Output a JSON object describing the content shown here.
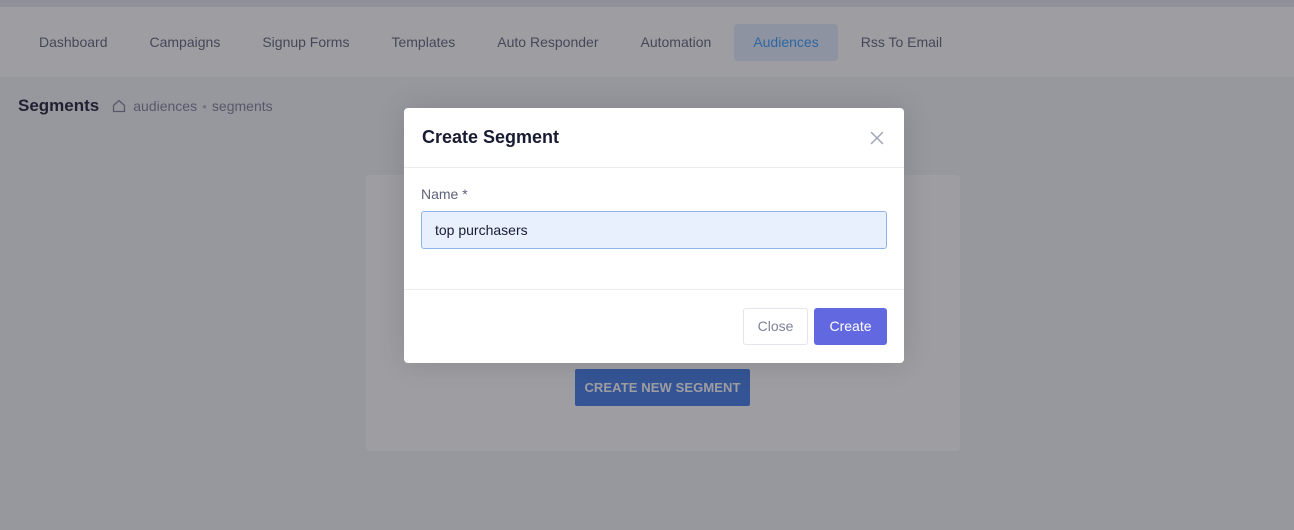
{
  "nav": {
    "items": [
      {
        "label": "Dashboard"
      },
      {
        "label": "Campaigns"
      },
      {
        "label": "Signup Forms"
      },
      {
        "label": "Templates"
      },
      {
        "label": "Auto Responder"
      },
      {
        "label": "Automation"
      },
      {
        "label": "Audiences",
        "active": true
      },
      {
        "label": "Rss To Email"
      }
    ]
  },
  "subheader": {
    "title": "Segments",
    "breadcrumb": [
      "audiences",
      "segments"
    ]
  },
  "content": {
    "create_button_label": "CREATE NEW SEGMENT"
  },
  "modal": {
    "title": "Create Segment",
    "name_label": "Name *",
    "name_value": "top purchasers",
    "close_label": "Close",
    "create_label": "Create"
  },
  "colors": {
    "accent": "#3699ff",
    "primary_button": "#6269e0",
    "create_new_button": "#3f79e8"
  },
  "icons": {
    "breadcrumb_home": "home-icon",
    "modal_close": "close-icon"
  }
}
